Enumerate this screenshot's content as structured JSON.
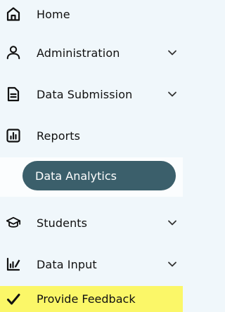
{
  "nav": {
    "items": [
      {
        "label": "Home",
        "icon": "home-icon"
      },
      {
        "label": "Administration",
        "icon": "user-icon",
        "expandable": true
      },
      {
        "label": "Data Submission",
        "icon": "document-icon",
        "expandable": true
      },
      {
        "label": "Reports",
        "icon": "bar-chart-icon"
      },
      {
        "label": "Data Analytics",
        "active": true
      },
      {
        "label": "Students",
        "icon": "graduation-cap-icon",
        "expandable": true
      },
      {
        "label": "Data Input",
        "icon": "chart-edit-icon",
        "expandable": true
      },
      {
        "label": "Provide Feedback",
        "icon": "check-icon",
        "highlight": true
      }
    ]
  },
  "colors": {
    "background": "#f0f7fb",
    "active_pill": "#3b5f6b",
    "feedback_highlight": "#fbf768",
    "text": "#111111"
  }
}
